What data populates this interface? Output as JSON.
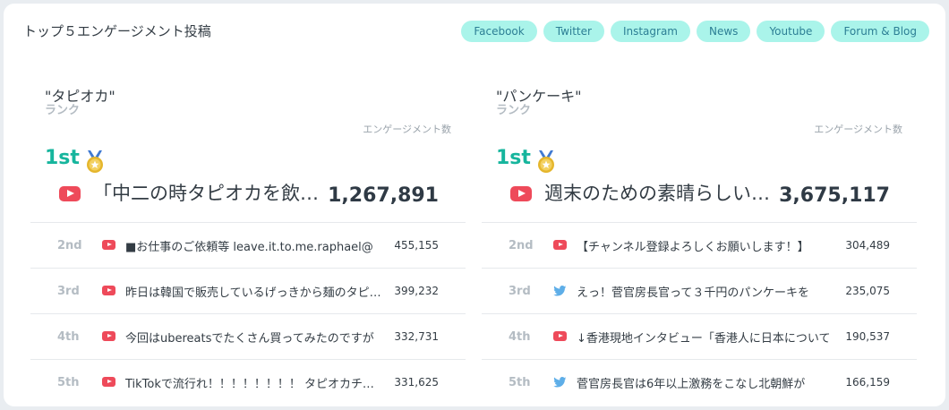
{
  "title": "トップ５エンゲージメント投稿",
  "filters": [
    "Facebook",
    "Twitter",
    "Instagram",
    "News",
    "Youtube",
    "Forum & Blog"
  ],
  "colors": {
    "accent": "#16b59d",
    "pill_bg": "#aaf4ea",
    "pill_text": "#2d7f95",
    "youtube": "#ee4a5a",
    "twitter": "#5eaee8",
    "medal": "#e5b62c"
  },
  "panels": [
    {
      "keyword": "\"タピオカ\"",
      "rank_header": "ランク",
      "engagement_header": "エンゲージメント数",
      "top": {
        "rank": "1st",
        "medal_icon": "medal-icon",
        "source_icon": "youtube-icon",
        "title": "「中二の時タピオカを飲んでいた話",
        "count": "1,267,891"
      },
      "rows": [
        {
          "rank": "2nd",
          "source_icon": "youtube-icon",
          "title": "■お仕事のご依頼等 leave.it.to.me.raphael@",
          "count": "455,155"
        },
        {
          "rank": "3rd",
          "source_icon": "youtube-icon",
          "title": "昨日は韓国で販売しているげっきから麺のタピオカ",
          "count": "399,232"
        },
        {
          "rank": "4th",
          "source_icon": "youtube-icon",
          "title": "今回はubereatsでたくさん買ってみたのですが",
          "count": "332,731"
        },
        {
          "rank": "5th",
          "source_icon": "youtube-icon",
          "title": "TikTokで流行れ！！！！！！！！ タピオカチャレンジ",
          "count": "331,625"
        }
      ]
    },
    {
      "keyword": "\"パンケーキ\"",
      "rank_header": "ランク",
      "engagement_header": "エンゲージメント数",
      "top": {
        "rank": "1st",
        "medal_icon": "medal-icon",
        "source_icon": "youtube-icon",
        "title": "週末のための素晴らしいパンケーキ",
        "count": "3,675,117"
      },
      "rows": [
        {
          "rank": "2nd",
          "source_icon": "youtube-icon",
          "title": "【チャンネル登録よろしくお願いします！】",
          "count": "304,489"
        },
        {
          "rank": "3rd",
          "source_icon": "twitter-icon",
          "title": "えっ！菅官房長官って３千円のパンケーキを",
          "count": "235,075"
        },
        {
          "rank": "4th",
          "source_icon": "youtube-icon",
          "title": "↓香港現地インタビュー「香港人に日本について",
          "count": "190,537"
        },
        {
          "rank": "5th",
          "source_icon": "twitter-icon",
          "title": "菅官房長官は6年以上激務をこなし北朝鮮が",
          "count": "166,159"
        }
      ]
    }
  ]
}
